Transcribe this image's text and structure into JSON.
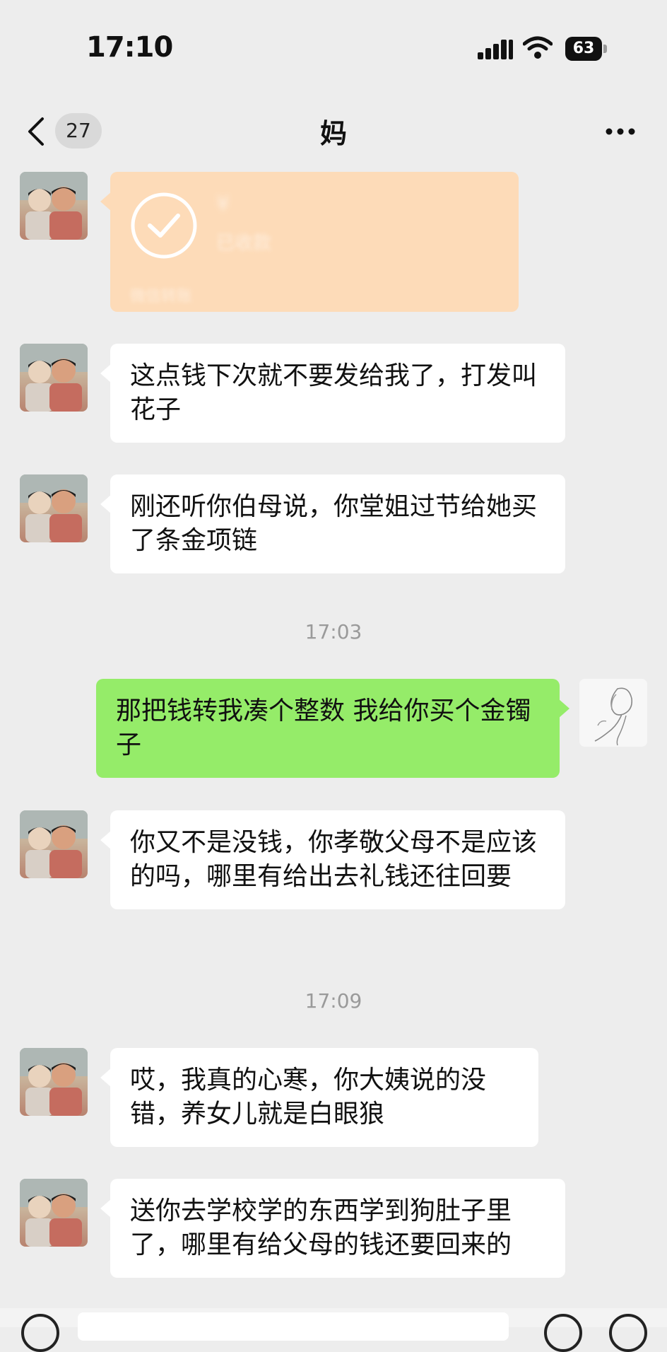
{
  "status_bar": {
    "time": "17:10",
    "battery": "63"
  },
  "nav": {
    "unread_count": "27",
    "title": "妈"
  },
  "transfer": {
    "amount": "¥",
    "status": "已收款",
    "footer": "微信转账"
  },
  "messages": [
    {
      "text": "这点钱下次就不要发给我了，打发叫花子"
    },
    {
      "text": "刚还听你伯母说，你堂姐过节给她买了条金项链"
    },
    {
      "text": "那把钱转我凑个整数 我给你买个金镯子"
    },
    {
      "text": "你又不是没钱，你孝敬父母不是应该的吗，哪里有给出去礼钱还往回要"
    },
    {
      "text": "哎，我真的心寒，你大姨说的没错，养女儿就是白眼狼"
    },
    {
      "text": "送你去学校学的东西学到狗肚子里了，哪里有给父母的钱还要回来的"
    }
  ],
  "timestamps": [
    "17:03",
    "17:09"
  ]
}
